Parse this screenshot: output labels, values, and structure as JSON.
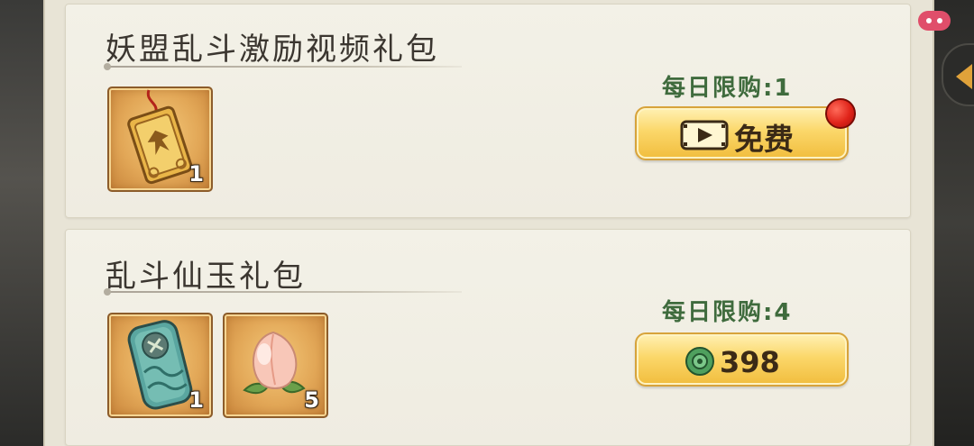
{
  "shop": {
    "packs": [
      {
        "title": "妖盟乱斗激励视频礼包",
        "limit": "每日限购:1",
        "button_label": "免费",
        "button_icon": "video-play-icon",
        "has_notification": true,
        "items": [
          {
            "icon": "golden-token-pendant-icon",
            "count": "1"
          }
        ]
      },
      {
        "title": "乱斗仙玉礼包",
        "limit": "每日限购:4",
        "button_price": "398",
        "button_icon": "jade-currency-icon",
        "has_notification": false,
        "items": [
          {
            "icon": "jade-tablet-icon",
            "count": "1"
          },
          {
            "icon": "peach-icon",
            "count": "5"
          }
        ]
      }
    ]
  },
  "colors": {
    "limit_text": "#3f6b3d",
    "button_gold": "#fbd76a",
    "card_bg": "#f3f1e7",
    "notification_red": "#e0241a"
  }
}
